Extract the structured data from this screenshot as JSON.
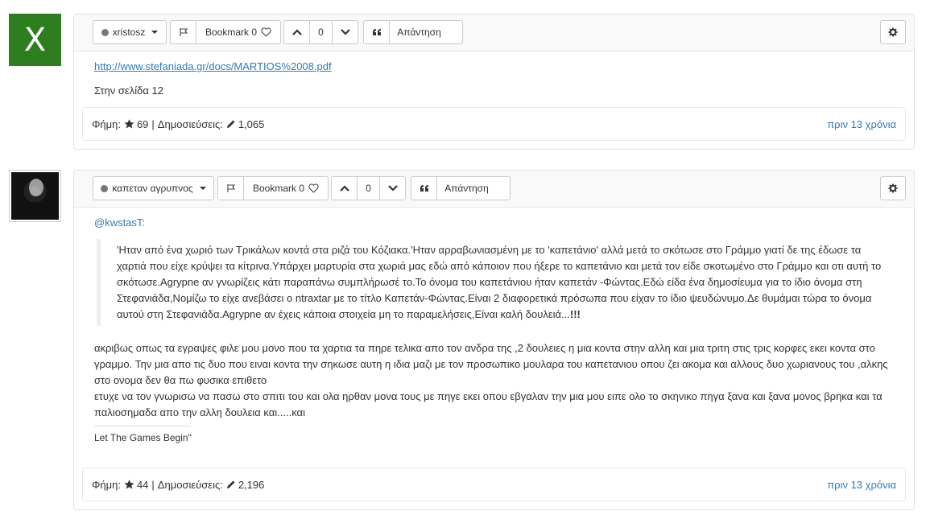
{
  "posts": [
    {
      "avatar_letter": "X",
      "username": "xristosz",
      "bookmark_label": "Bookmark 0",
      "vote_count": "0",
      "reply_label": "Απάντηση",
      "link": "http://www.stefaniada.gr/docs/MARTIOS%2008.pdf",
      "text": "Στην σελίδα 12",
      "rep_label": "Φήμη:",
      "rep_value": "69",
      "sep": "|",
      "posts_label": "Δημοσιεύσεις:",
      "posts_value": "1,065",
      "time": "πριν 13 χρόνια"
    },
    {
      "username": "καπεταν αγρυπνος",
      "bookmark_label": "Bookmark 0",
      "vote_count": "0",
      "reply_label": "Απάντηση",
      "mention": "@kwstasT:",
      "quote": "'Ηταν από ένα χωριό των Τρικάλων κοντά στα ριζά του Κόζιακα.'Ηταν αρραβωνιασμένη με το 'καπετάνιο' αλλά μετά το σκότωσε στο Γράμμο γιατί δε της έδωσε τα χαρτιά που είχε κρύψει τα κίτρινα.Υπάρχει μαρτυρία στα χωριά μας εδώ από κάποιον που ήξερε το καπετάνιο και μετά τον είδε σκοτωμένο στο Γράμμο και οτι αυτή το σκότωσε.Agrypne αν γνωρίζεις κάτι παραπάνω συμπλήρωσέ το.Το όνομα του καπετάνιου ήταν καπετάν -Φώντας.Εδώ είδα ένα δημοσίευμα για το ίδιο όνομα στη Στεφανιάδα,Νομίζω το είχε ανεβάσει ο ntraxtar με το τίτλο Καπετάν-Φώντας.Είναι 2 διαφορετικά πρόσωπα που είχαν το ίδιο ψευδώνυμο.Δε θυμάμαι τώρα το όνομα αυτού στη Στεφανιάδα.Agrypne αν έχεις κάποια στοιχεία μη το παραμελήσεις,Είναι καλή δουλειά...",
      "quote_bold": "!!!",
      "body_line1": "ακριβως οπως τα εγραψες φιλε μου μονο που τα χαρτια τα πηρε τελικα απο τον ανδρα της ,2 δουλειες η μια κοντα στην αλλη και μια τριτη στις τρις κορφες εκει κοντα στο γραμμο. Την μια απο τις δυο που ειναι κοντα την σηκωσε αυτη η ιδια μαζι με τον προσωπικο μουλαρα του καπετανιου οπου ζει ακομα και αλλους δυο χωριανους του ,αλκης στο ονομα δεν θα πω φυσικα επιθετο",
      "body_line2": "ετυχε να τον γνωρισω να πασω στο σπιτι του και ολα ηρθαν μονα τους με πηγε εκει οπου εβγαλαν την μια μου ειπε ολο το σκηνικο πηγα ξανα και ξανα μονος βρηκα και τα παλιοσημαδα απο την αλλη δουλεια και.....και",
      "signature": "Let The Games Begin\"",
      "rep_label": "Φήμη:",
      "rep_value": "44",
      "sep": "|",
      "posts_label": "Δημοσιεύσεις:",
      "posts_value": "2,196",
      "time": "πριν 13 χρόνια"
    }
  ],
  "icons": {
    "flag": "flag-icon",
    "heart": "heart-icon",
    "up": "chevron-up-icon",
    "down": "chevron-down-icon",
    "quote": "quote-icon",
    "reply": "reply-icon",
    "gear": "gear-icon",
    "star": "star-icon",
    "pencil": "pencil-icon"
  },
  "colors": {
    "accent": "#337ab7",
    "avatar_bg": "#2e7d1f"
  }
}
